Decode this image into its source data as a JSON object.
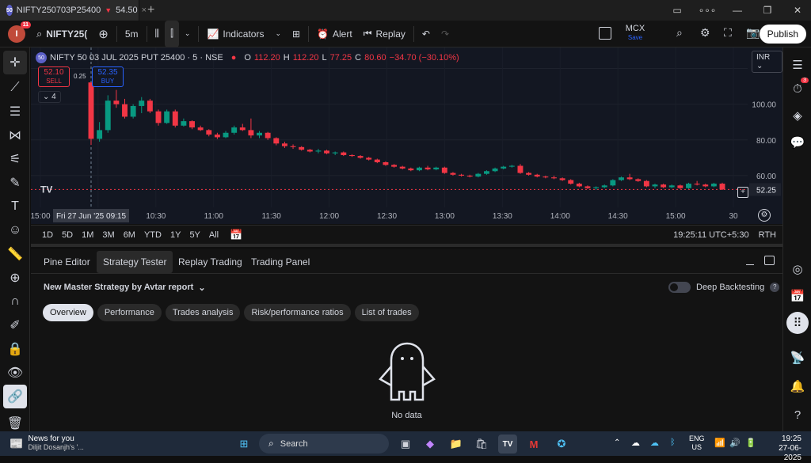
{
  "browser_tab": {
    "logo": "50",
    "title": "NIFTY250703P25400",
    "change_arrow": "▼",
    "price": "54.50",
    "close": "×",
    "new_tab": "+"
  },
  "window_controls": [
    "▭",
    "∘∘∘",
    "—",
    "❐",
    "✕"
  ],
  "toolbar": {
    "avatar_letter": "I",
    "avatar_badge": "11",
    "symbol": "NIFTY25(",
    "interval": "5m",
    "indicators_label": "Indicators",
    "alert_label": "Alert",
    "replay_label": "Replay",
    "exchange": "MCX",
    "exchange_sub": "Save",
    "publish_label": "Publish"
  },
  "legend": {
    "logo": "50",
    "title": "NIFTY 50 03 JUL 2025 PUT 25400 · 5 · NSE",
    "o_key": "O",
    "o": "112.20",
    "h_key": "H",
    "h": "112.20",
    "l_key": "L",
    "l": "77.25",
    "c_key": "C",
    "c": "80.60",
    "change": "−34.70 (−30.10%)"
  },
  "trade_buttons": {
    "sell_price": "52.10",
    "sell_label": "SELL",
    "spread": "0.25",
    "buy_price": "52.35",
    "buy_label": "BUY"
  },
  "indicator_count": "4",
  "currency": "INR",
  "price_axis": [
    "120.00",
    "100.00",
    "80.00",
    "60.00"
  ],
  "last_price": "52.25",
  "time_axis": [
    "15:00",
    "10:00",
    "10:30",
    "11:00",
    "11:30",
    "12:00",
    "12:30",
    "13:00",
    "13:30",
    "14:00",
    "14:30",
    "15:00",
    "30"
  ],
  "crosshair_label": "Fri 27 Jun '25   09:15",
  "ranges": [
    "1D",
    "5D",
    "1M",
    "3M",
    "6M",
    "YTD",
    "1Y",
    "5Y",
    "All"
  ],
  "clock": "19:25:11 UTC+5:30",
  "session": "RTH",
  "panel_tabs": [
    "Pine Editor",
    "Strategy Tester",
    "Replay Trading",
    "Trading Panel"
  ],
  "strategy_name": "New Master Strategy by Avtar report",
  "deep_backtesting": "Deep Backtesting",
  "report_tabs": [
    "Overview",
    "Performance",
    "Trades analysis",
    "Risk/performance ratios",
    "List of trades"
  ],
  "empty_message": "No data",
  "right_badge": "3",
  "taskbar": {
    "news_title": "News for you",
    "news_sub": "Diljit Dosanjh's '...",
    "search_placeholder": "Search",
    "lang": "ENG",
    "region": "US",
    "time": "19:25",
    "date": "27-06-2025"
  },
  "colors": {
    "up": "#089981",
    "down": "#f23645",
    "chart_bg": "#131722",
    "accent": "#2962ff"
  },
  "chart_data": {
    "type": "candlestick",
    "title": "NIFTY 50 03 JUL 2025 PUT 25400 · 5 · NSE",
    "x_ticks": [
      "15:00",
      "10:00",
      "10:30",
      "11:00",
      "11:30",
      "12:00",
      "12:30",
      "13:00",
      "13:30",
      "14:00",
      "14:30",
      "15:00",
      "30"
    ],
    "y_ticks": [
      120,
      100,
      80,
      60
    ],
    "ylim": [
      44,
      130
    ],
    "last_price": 52.25,
    "candles": [
      [
        112.2,
        112.2,
        77.25,
        80.6
      ],
      [
        80.6,
        90,
        79,
        85.5
      ],
      [
        85.5,
        105,
        84,
        102
      ],
      [
        102,
        108,
        98,
        100
      ],
      [
        100,
        103,
        92,
        93
      ],
      [
        93,
        100,
        92,
        99
      ],
      [
        99,
        104,
        95,
        102
      ],
      [
        102,
        103,
        95,
        96
      ],
      [
        96,
        97,
        88,
        89.5
      ],
      [
        89.5,
        97,
        89,
        96
      ],
      [
        96,
        97,
        87,
        88
      ],
      [
        88,
        92,
        87.5,
        90.5
      ],
      [
        90.5,
        91,
        86,
        87
      ],
      [
        87,
        88,
        85,
        85.5
      ],
      [
        85.5,
        86,
        82,
        83
      ],
      [
        83,
        84,
        80.5,
        81.5
      ],
      [
        81.5,
        85,
        81,
        84
      ],
      [
        84,
        88,
        83,
        87
      ],
      [
        87,
        89,
        85,
        85.5
      ],
      [
        85.5,
        92,
        81,
        82.5
      ],
      [
        82.5,
        85,
        81,
        84
      ],
      [
        84,
        84.5,
        80,
        81
      ],
      [
        81,
        81.5,
        77,
        78
      ],
      [
        78,
        79,
        75.5,
        76.5
      ],
      [
        76.5,
        77.5,
        75,
        76
      ],
      [
        76,
        76.5,
        74,
        74.5
      ],
      [
        74.5,
        75,
        73,
        73.5
      ],
      [
        73.5,
        75,
        72.5,
        74
      ],
      [
        74,
        74.5,
        72,
        72.5
      ],
      [
        72.5,
        73.5,
        71.5,
        73
      ],
      [
        73,
        73.5,
        71,
        71.5
      ],
      [
        71.5,
        72,
        70.5,
        71
      ],
      [
        71,
        71.5,
        69.5,
        70
      ],
      [
        70,
        70.5,
        68.5,
        69
      ],
      [
        69,
        69.5,
        67,
        67.5
      ],
      [
        67.5,
        68,
        65.5,
        66
      ],
      [
        66,
        66.5,
        64.5,
        65
      ],
      [
        65,
        65.5,
        63.5,
        64
      ],
      [
        64,
        64.5,
        62.5,
        63
      ],
      [
        63,
        65,
        62.5,
        64.5
      ],
      [
        64.5,
        65.5,
        63,
        63.5
      ],
      [
        63.5,
        65,
        63,
        64.5
      ],
      [
        64.5,
        65,
        61,
        61.5
      ],
      [
        61.5,
        62,
        60,
        60.5
      ],
      [
        60.5,
        61,
        59.5,
        60
      ],
      [
        60,
        60.5,
        59,
        59.5
      ],
      [
        59.5,
        61.5,
        59,
        61
      ],
      [
        61,
        63,
        60.5,
        62.5
      ],
      [
        62.5,
        64.5,
        62,
        64
      ],
      [
        64,
        65.5,
        63.5,
        65
      ],
      [
        65,
        66,
        64.5,
        65.5
      ],
      [
        65.5,
        66.5,
        61,
        61.5
      ],
      [
        61.5,
        62,
        60,
        60.5
      ],
      [
        60.5,
        61,
        59,
        59.5
      ],
      [
        59.5,
        60,
        58.5,
        59
      ],
      [
        59,
        60,
        58,
        58.5
      ],
      [
        58.5,
        59,
        57,
        57.5
      ],
      [
        57.5,
        58,
        55,
        55.5
      ],
      [
        55.5,
        56,
        53.5,
        54
      ],
      [
        54,
        54.5,
        52.5,
        53
      ],
      [
        53,
        54,
        52,
        53.5
      ],
      [
        53.5,
        55,
        53,
        54.5
      ],
      [
        54.5,
        58,
        54,
        57.5
      ],
      [
        57.5,
        59.5,
        57,
        59
      ],
      [
        59,
        61,
        57.5,
        58
      ],
      [
        58,
        58.5,
        56.5,
        57
      ],
      [
        57,
        57.5,
        53.5,
        54
      ],
      [
        54,
        55.5,
        53,
        55
      ],
      [
        55,
        55.5,
        53,
        53.5
      ],
      [
        53.5,
        55,
        53,
        54.5
      ],
      [
        54.5,
        55,
        52.5,
        53
      ],
      [
        53,
        56,
        52.5,
        55.5
      ],
      [
        55.5,
        57,
        54.5,
        55
      ],
      [
        55,
        55.5,
        53.5,
        54
      ],
      [
        54,
        56,
        53.5,
        55.5
      ],
      [
        55.5,
        56,
        52,
        52.25
      ]
    ]
  }
}
